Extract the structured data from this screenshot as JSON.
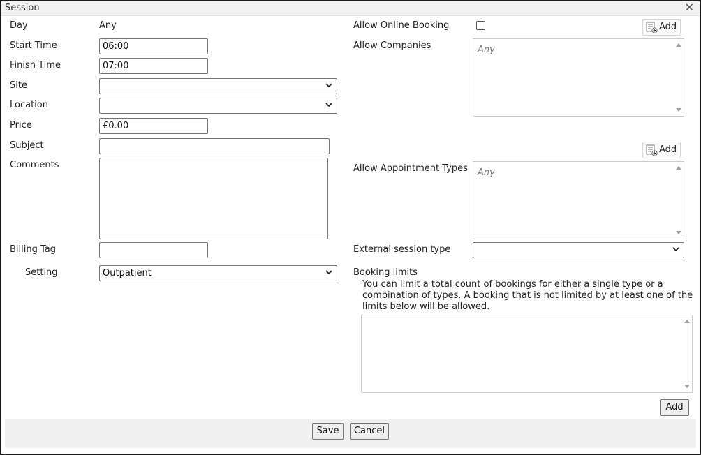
{
  "dialog": {
    "title": "Session",
    "close_symbol": "✕"
  },
  "left": {
    "day": {
      "label": "Day",
      "value": "Any"
    },
    "start_time": {
      "label": "Start Time",
      "value": "06:00"
    },
    "finish_time": {
      "label": "Finish Time",
      "value": "07:00"
    },
    "site": {
      "label": "Site",
      "value": ""
    },
    "location": {
      "label": "Location",
      "value": ""
    },
    "price": {
      "label": "Price",
      "value": "£0.00"
    },
    "subject": {
      "label": "Subject",
      "value": ""
    },
    "comments": {
      "label": "Comments",
      "value": ""
    },
    "billing_tag": {
      "label": "Billing Tag",
      "value": ""
    },
    "setting": {
      "label": "Setting",
      "value": "Outpatient"
    }
  },
  "right": {
    "allow_online_booking": {
      "label": "Allow Online Booking",
      "checked": false
    },
    "allow_companies": {
      "label": "Allow Companies",
      "placeholder": "Any",
      "add_label": "Add"
    },
    "allow_appointment_types": {
      "label": "Allow Appointment Types",
      "placeholder": "Any",
      "add_label": "Add"
    },
    "external_session_type": {
      "label": "External session type",
      "value": ""
    },
    "booking_limits": {
      "label": "Booking limits",
      "description": "You can limit a total count of bookings for either a single type or a combination of types. A booking that is not limited by at least one of the limits below will be allowed.",
      "add_label": "Add"
    }
  },
  "footer": {
    "save_label": "Save",
    "cancel_label": "Cancel"
  },
  "icons": {
    "close": "close-icon",
    "add_list": "list-add-icon",
    "chevron": "chevron-down-icon"
  }
}
